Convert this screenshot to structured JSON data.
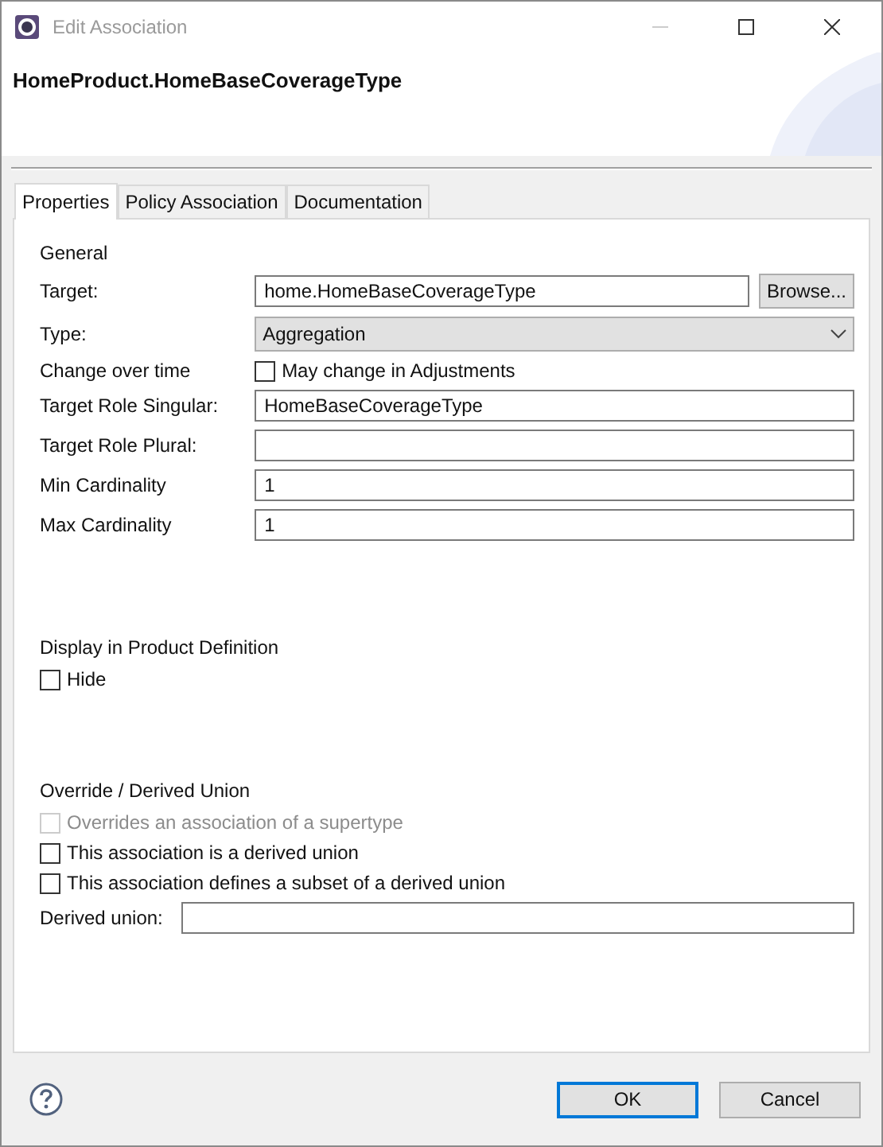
{
  "window": {
    "title": "Edit Association"
  },
  "header": {
    "title": "HomeProduct.HomeBaseCoverageType"
  },
  "tabs": [
    {
      "label": "Properties",
      "selected": true
    },
    {
      "label": "Policy Association",
      "selected": false
    },
    {
      "label": "Documentation",
      "selected": false
    }
  ],
  "sections": [
    {
      "title": "General",
      "rows": [
        {
          "kind": "text",
          "label": "Target:",
          "value": "home.HomeBaseCoverageType",
          "button": "Browse..."
        },
        {
          "kind": "select",
          "label": "Type:",
          "value": "Aggregation"
        },
        {
          "kind": "checkbox",
          "label": "Change over time",
          "text": "May change in Adjustments",
          "checked": false,
          "disabled": false
        },
        {
          "kind": "text",
          "label": "Target Role Singular:",
          "value": "HomeBaseCoverageType"
        },
        {
          "kind": "text",
          "label": "Target Role Plural:"
        },
        {
          "kind": "text",
          "label": "Min Cardinality",
          "value": "1"
        },
        {
          "kind": "text",
          "label": "Max Cardinality",
          "value": "1"
        }
      ]
    },
    {
      "title": "Display in Product Definition",
      "rows": [
        {
          "kind": "checkbox",
          "text": "Hide",
          "checked": false,
          "disabled": false
        }
      ]
    },
    {
      "title": "Override / Derived Union",
      "rows": [
        {
          "kind": "checkbox",
          "text": "Overrides an association of a supertype",
          "checked": false,
          "disabled": true
        },
        {
          "kind": "checkbox",
          "text": "This association is a derived union",
          "checked": false,
          "disabled": false
        },
        {
          "kind": "checkbox",
          "text": "This association defines a subset of a derived union",
          "checked": false,
          "disabled": false
        },
        {
          "kind": "text",
          "label": "Derived union:"
        }
      ]
    }
  ],
  "buttons": [
    {
      "label": "OK",
      "default": true
    },
    {
      "label": "Cancel",
      "default": false
    }
  ]
}
